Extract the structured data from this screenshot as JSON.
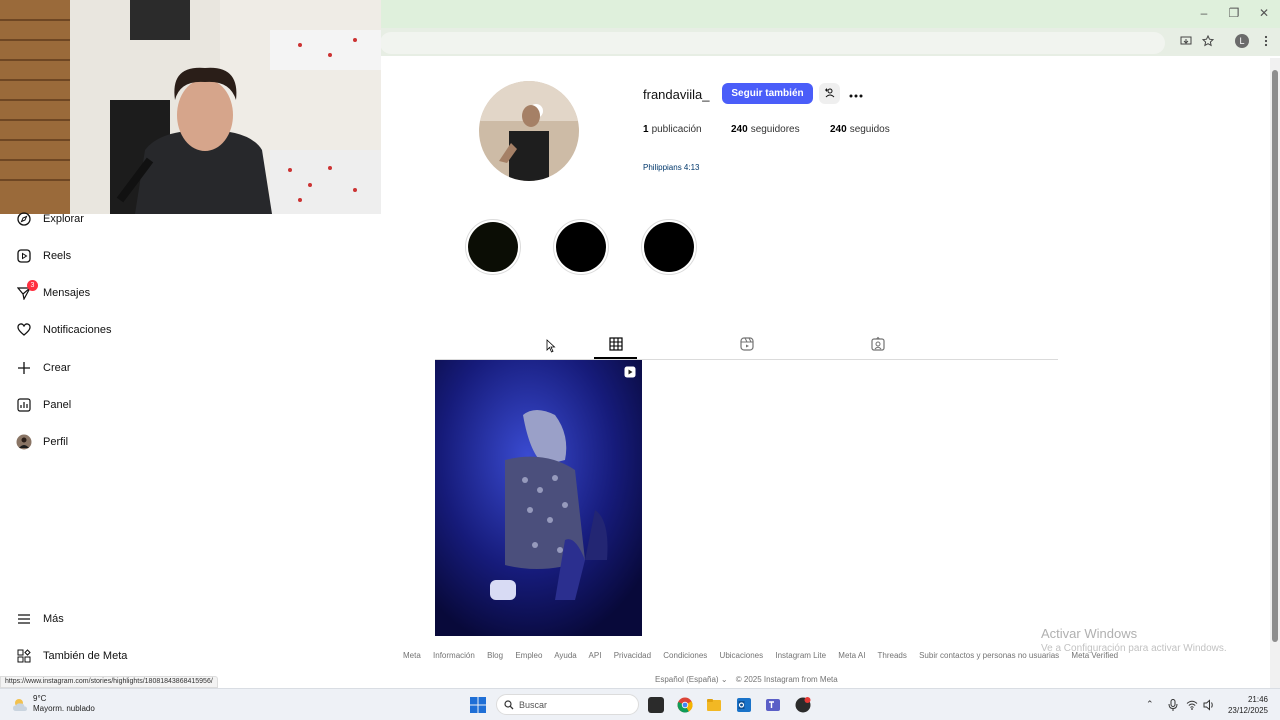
{
  "window": {
    "controls": [
      "–",
      "❐",
      "✕"
    ]
  },
  "sidebar": {
    "items": [
      {
        "label": "Explorar",
        "icon": "compass-icon"
      },
      {
        "label": "Reels",
        "icon": "reels-icon"
      },
      {
        "label": "Mensajes",
        "icon": "messenger-icon",
        "badge": "3"
      },
      {
        "label": "Notificaciones",
        "icon": "heart-icon"
      },
      {
        "label": "Crear",
        "icon": "plus-icon"
      },
      {
        "label": "Panel",
        "icon": "chart-icon"
      },
      {
        "label": "Perfil",
        "icon": "avatar-icon"
      }
    ],
    "more_label": "Más",
    "meta_label": "También de Meta"
  },
  "profile": {
    "username": "frandaviila_",
    "follow_label": "Seguir también",
    "posts_count": "1",
    "posts_label": "publicación",
    "followers_count": "240",
    "followers_label": "seguidores",
    "following_count": "240",
    "following_label": "seguidos",
    "bio": "Philippians 4:13"
  },
  "footer": {
    "links": [
      "Meta",
      "Información",
      "Blog",
      "Empleo",
      "Ayuda",
      "API",
      "Privacidad",
      "Condiciones",
      "Ubicaciones",
      "Instagram Lite",
      "Meta AI",
      "Threads",
      "Subir contactos y personas no usuarias",
      "Meta Verified"
    ],
    "language": "Español (España)",
    "copyright": "© 2025 Instagram from Meta"
  },
  "watermark": {
    "title": "Activar Windows",
    "subtitle": "Ve a Configuración para activar Windows."
  },
  "status_url": "https://www.instagram.com/stories/highlights/18081843868415956/",
  "taskbar": {
    "temperature": "9°C",
    "weather": "Mayorm. nublado",
    "search_placeholder": "Buscar",
    "time": "21:46",
    "date": "23/12/2025"
  },
  "colors": {
    "accent": "#4a5df9",
    "badge": "#ff3040"
  }
}
